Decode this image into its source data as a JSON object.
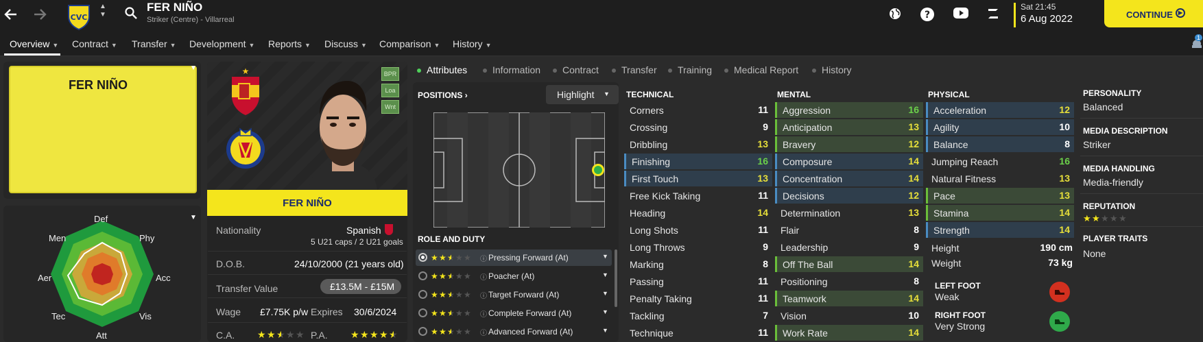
{
  "header": {
    "player_name": "FER NIÑO",
    "subtitle": "Striker (Centre) - Villarreal",
    "date_day": "Sat 21:45",
    "date_full": "6 Aug 2022",
    "continue_label": "CONTINUE",
    "notification_count": "1"
  },
  "nav": [
    "Overview",
    "Contract",
    "Transfer",
    "Development",
    "Reports",
    "Discuss",
    "Comparison",
    "History"
  ],
  "kit_name": "FER NIÑO",
  "profile": {
    "name_banner": "FER NIÑO",
    "badges": [
      "BPR",
      "Loa",
      "Wnt"
    ],
    "nationality_label": "Nationality",
    "nationality": "Spanish",
    "caps": "5 U21 caps / 2 U21 goals",
    "dob_label": "D.O.B.",
    "dob": "24/10/2000 (21 years old)",
    "transfer_label": "Transfer Value",
    "transfer_value": "£13.5M - £15M",
    "wage_label": "Wage",
    "wage": "£7.75K p/w",
    "expires_label": "Expires",
    "expires": "30/6/2024",
    "ca_label": "C.A.",
    "pa_label": "P.A.",
    "ca_stars": 2.5,
    "pa_stars": 4.5
  },
  "tabs": [
    "Attributes",
    "Information",
    "Contract",
    "Transfer",
    "Training",
    "Medical Report",
    "History"
  ],
  "positions": {
    "title": "POSITIONS",
    "highlight_label": "Highlight"
  },
  "role_duty": {
    "title": "ROLE AND DUTY",
    "roles": [
      {
        "name": "Pressing Forward (At)",
        "stars": 2.5
      },
      {
        "name": "Poacher (At)",
        "stars": 2.5
      },
      {
        "name": "Target Forward (At)",
        "stars": 2.5
      },
      {
        "name": "Complete Forward (At)",
        "stars": 2.5
      },
      {
        "name": "Advanced Forward (At)",
        "stars": 2.5
      }
    ]
  },
  "radar_labels": [
    "Def",
    "Phy",
    "Acc",
    "Vis",
    "Att",
    "Tec",
    "Aer",
    "Men"
  ],
  "attributes": {
    "technical_title": "TECHNICAL",
    "mental_title": "MENTAL",
    "physical_title": "PHYSICAL",
    "technical": [
      {
        "name": "Corners",
        "value": 11,
        "hl": ""
      },
      {
        "name": "Crossing",
        "value": 9,
        "hl": ""
      },
      {
        "name": "Dribbling",
        "value": 13,
        "hl": ""
      },
      {
        "name": "Finishing",
        "value": 16,
        "hl": "blue"
      },
      {
        "name": "First Touch",
        "value": 13,
        "hl": "blue"
      },
      {
        "name": "Free Kick Taking",
        "value": 11,
        "hl": ""
      },
      {
        "name": "Heading",
        "value": 14,
        "hl": ""
      },
      {
        "name": "Long Shots",
        "value": 11,
        "hl": ""
      },
      {
        "name": "Long Throws",
        "value": 9,
        "hl": ""
      },
      {
        "name": "Marking",
        "value": 8,
        "hl": ""
      },
      {
        "name": "Passing",
        "value": 11,
        "hl": ""
      },
      {
        "name": "Penalty Taking",
        "value": 11,
        "hl": ""
      },
      {
        "name": "Tackling",
        "value": 7,
        "hl": ""
      },
      {
        "name": "Technique",
        "value": 11,
        "hl": ""
      }
    ],
    "mental": [
      {
        "name": "Aggression",
        "value": 16,
        "hl": "green"
      },
      {
        "name": "Anticipation",
        "value": 13,
        "hl": "green"
      },
      {
        "name": "Bravery",
        "value": 12,
        "hl": "green"
      },
      {
        "name": "Composure",
        "value": 14,
        "hl": "blue"
      },
      {
        "name": "Concentration",
        "value": 14,
        "hl": "blue"
      },
      {
        "name": "Decisions",
        "value": 12,
        "hl": "blue"
      },
      {
        "name": "Determination",
        "value": 13,
        "hl": ""
      },
      {
        "name": "Flair",
        "value": 8,
        "hl": ""
      },
      {
        "name": "Leadership",
        "value": 9,
        "hl": ""
      },
      {
        "name": "Off The Ball",
        "value": 14,
        "hl": "green"
      },
      {
        "name": "Positioning",
        "value": 8,
        "hl": ""
      },
      {
        "name": "Teamwork",
        "value": 14,
        "hl": "green"
      },
      {
        "name": "Vision",
        "value": 10,
        "hl": ""
      },
      {
        "name": "Work Rate",
        "value": 14,
        "hl": "green"
      }
    ],
    "physical": [
      {
        "name": "Acceleration",
        "value": 12,
        "hl": "blue"
      },
      {
        "name": "Agility",
        "value": 10,
        "hl": "blue"
      },
      {
        "name": "Balance",
        "value": 8,
        "hl": "blue"
      },
      {
        "name": "Jumping Reach",
        "value": 16,
        "hl": ""
      },
      {
        "name": "Natural Fitness",
        "value": 13,
        "hl": ""
      },
      {
        "name": "Pace",
        "value": 13,
        "hl": "green"
      },
      {
        "name": "Stamina",
        "value": 14,
        "hl": "green"
      },
      {
        "name": "Strength",
        "value": 14,
        "hl": "blue"
      }
    ],
    "height_label": "Height",
    "height": "190 cm",
    "weight_label": "Weight",
    "weight": "73 kg",
    "left_foot_label": "LEFT FOOT",
    "left_foot": "Weak",
    "right_foot_label": "RIGHT FOOT",
    "right_foot": "Very Strong"
  },
  "side": {
    "personality_label": "PERSONALITY",
    "personality": "Balanced",
    "media_desc_label": "MEDIA DESCRIPTION",
    "media_desc": "Striker",
    "media_handling_label": "MEDIA HANDLING",
    "media_handling": "Media-friendly",
    "reputation_label": "REPUTATION",
    "reputation_stars": 2,
    "traits_label": "PLAYER TRAITS",
    "traits": "None"
  },
  "colors": {
    "accent_yellow": "#f4e51c",
    "value_green": "#6bd14a",
    "value_yellow": "#e7df3a",
    "value_white": "#ffffff"
  }
}
